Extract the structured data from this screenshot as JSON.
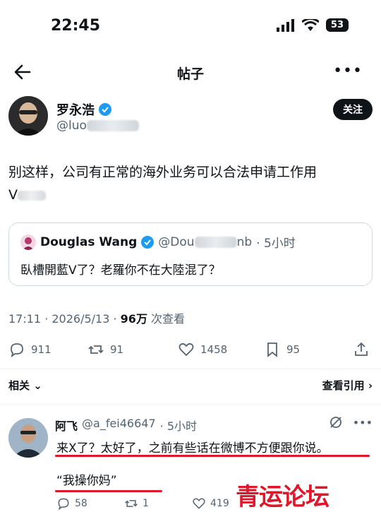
{
  "status_bar": {
    "time": "22:45",
    "battery": "53"
  },
  "nav": {
    "title": "帖子",
    "more": "•••"
  },
  "author": {
    "name": "罗永浩",
    "handle_prefix": "@luo",
    "follow_label": "关注"
  },
  "tweet": {
    "text": "别这样，公司有正常的海外业务可以合法申请工作用",
    "text_line2_prefix": "V"
  },
  "quote": {
    "name": "Douglas Wang",
    "handle_prefix": "@Dou",
    "handle_suffix": "nb",
    "time": "· 5小时",
    "text": "臥槽開藍V了？老羅你不在大陸混了？"
  },
  "meta": {
    "time": "17:11 · 2026/5/13 · ",
    "views": "96万",
    "views_label": " 次查看"
  },
  "actions": {
    "replies": "911",
    "reposts": "91",
    "likes": "1458",
    "bookmarks": "95"
  },
  "related": {
    "left": "相关",
    "right": "查看引用"
  },
  "reply": {
    "name": "阿飞",
    "handle": "@a_fei46647",
    "time": "· 5小时",
    "line1": "来X了？太好了，之前有些话在微博不方便跟你说。",
    "line2": "“我操你妈”",
    "replies": "58",
    "reposts": "1",
    "likes": "419"
  },
  "watermark": "青运论坛",
  "colors": {
    "accent": "#1d9bf0",
    "highlight": "#e0162b",
    "text": "#0f1419",
    "muted": "#536471"
  }
}
